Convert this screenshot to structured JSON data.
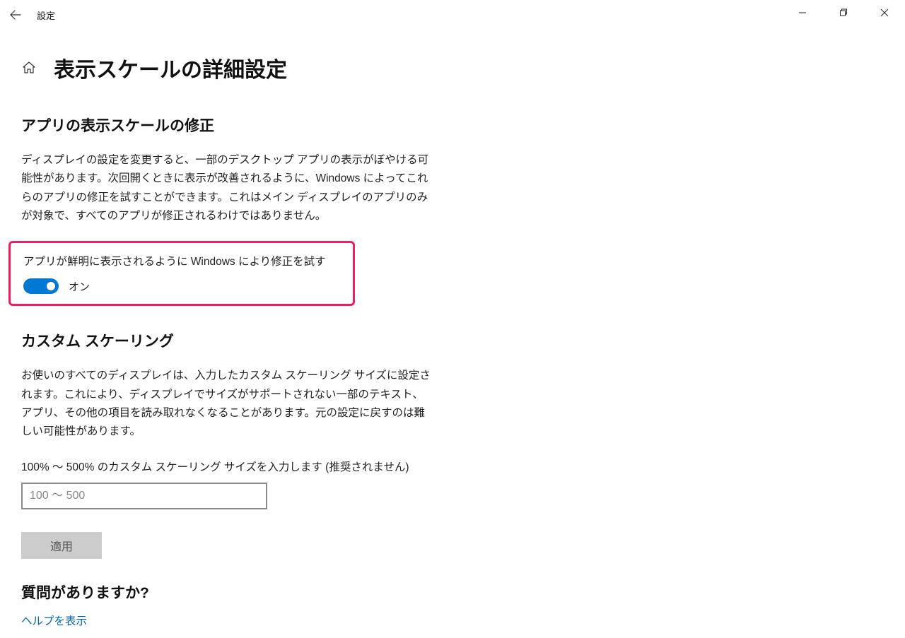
{
  "app": {
    "title": "設定"
  },
  "page": {
    "title": "表示スケールの詳細設定"
  },
  "section1": {
    "title": "アプリの表示スケールの修正",
    "description": "ディスプレイの設定を変更すると、一部のデスクトップ アプリの表示がぼやける可能性があります。次回開くときに表示が改善されるように、Windows によってこれらのアプリの修正を試すことができます。これはメイン ディスプレイのアプリのみが対象で、すべてのアプリが修正されるわけではありません。",
    "toggle_label": "アプリが鮮明に表示されるように Windows により修正を試す",
    "toggle_state": "オン"
  },
  "section2": {
    "title": "カスタム スケーリング",
    "description": "お使いのすべてのディスプレイは、入力したカスタム スケーリング サイズに設定されます。これにより、ディスプレイでサイズがサポートされない一部のテキスト、アプリ、その他の項目を読み取れなくなることがあります。元の設定に戻すのは難しい可能性があります。",
    "input_label": "100% ～ 500% のカスタム スケーリング サイズを入力します (推奨されません)",
    "input_placeholder": "100 ～ 500",
    "apply_label": "適用"
  },
  "help": {
    "title": "質問がありますか?",
    "link": "ヘルプを表示"
  }
}
